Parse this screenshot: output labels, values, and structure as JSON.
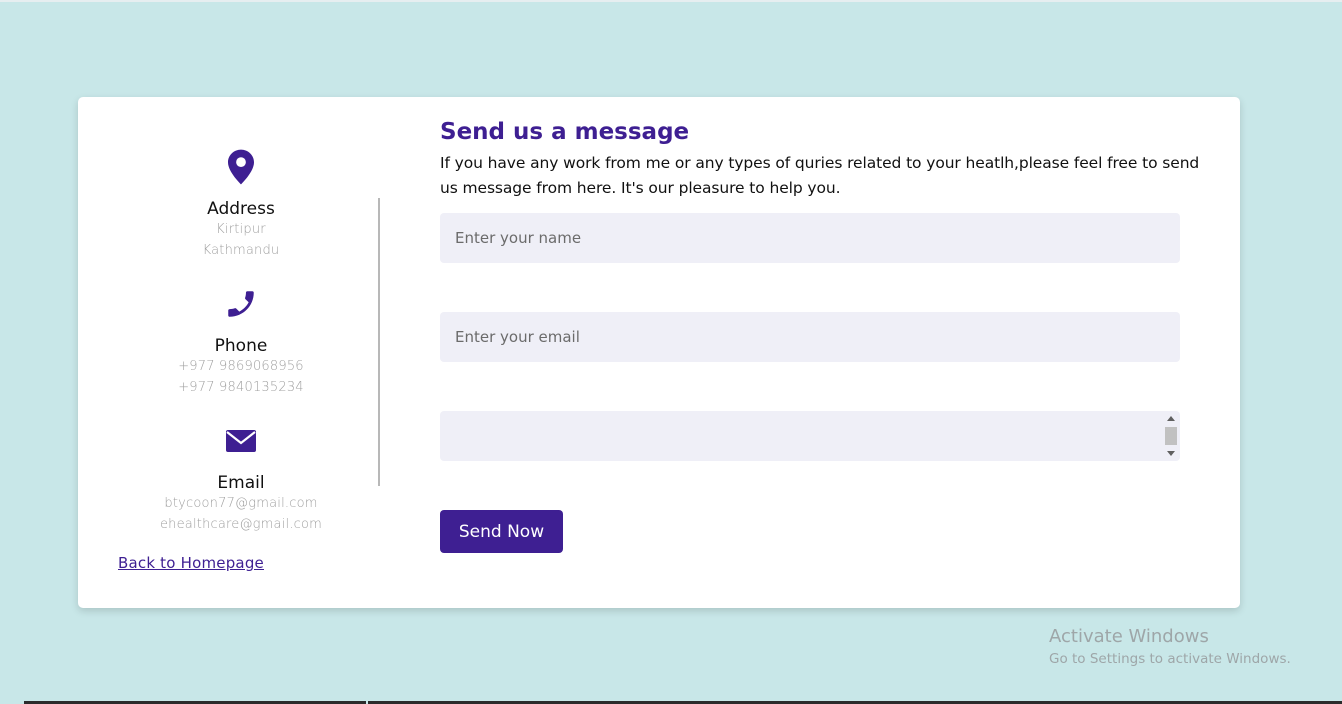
{
  "contact": {
    "address": {
      "icon": "map-pin-icon",
      "topic": "Address",
      "lines": [
        "Kirtipur",
        "Kathmandu"
      ]
    },
    "phone": {
      "icon": "phone-icon",
      "topic": "Phone",
      "lines": [
        "+977 9869068956",
        "+977 9840135234"
      ]
    },
    "email": {
      "icon": "envelope-icon",
      "topic": "Email",
      "lines": [
        "btycoon77@gmail.com",
        "ehealthcare@gmail.com"
      ]
    },
    "back_link": "Back to Homepage"
  },
  "form": {
    "title": "Send us a message",
    "description": "If you have any work from me or any types of quries related to your heatlh,please feel free to send us message from here. It's our pleasure to help you.",
    "name_placeholder": "Enter your name",
    "name_value": "",
    "email_placeholder": "Enter your email",
    "email_value": "",
    "message_value": "",
    "send_label": "Send Now"
  },
  "watermark": {
    "title": "Activate Windows",
    "subtitle": "Go to Settings to activate Windows."
  },
  "colors": {
    "page_background": "#c8e7e8",
    "accent": "#3e1f92",
    "input_background": "#efeff7"
  }
}
